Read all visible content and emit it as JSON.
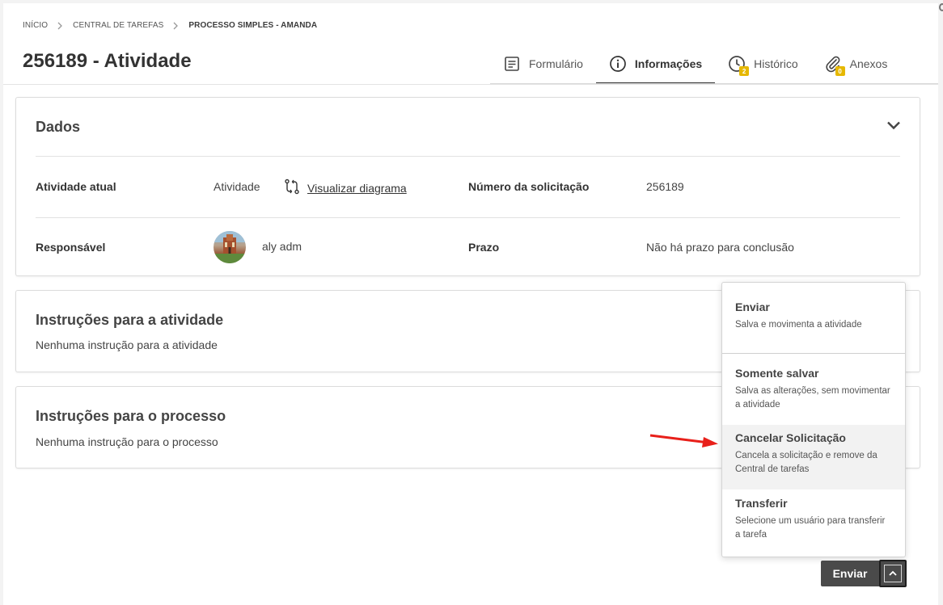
{
  "breadcrumb": [
    {
      "label": "INÍCIO"
    },
    {
      "label": "CENTRAL DE TAREFAS"
    },
    {
      "label": "PROCESSO SIMPLES - AMANDA"
    }
  ],
  "page": {
    "title": "256189 - Atividade"
  },
  "tabs": [
    {
      "label": "Formulário",
      "icon": "form-icon"
    },
    {
      "label": "Informações",
      "icon": "info-icon",
      "active": true
    },
    {
      "label": "Histórico",
      "icon": "clock-icon",
      "badge": "2"
    },
    {
      "label": "Anexos",
      "icon": "paperclip-icon",
      "badge": "0"
    }
  ],
  "dados": {
    "title": "Dados",
    "atividade_atual_label": "Atividade atual",
    "atividade_atual_value": "Atividade",
    "diagram_link": "Visualizar diagrama",
    "numero_label": "Número da solicitação",
    "numero_value": "256189",
    "responsavel_label": "Responsável",
    "responsavel_value": "aly adm",
    "prazo_label": "Prazo",
    "prazo_value": "Não há prazo para conclusão"
  },
  "instrucoes_atividade": {
    "title": "Instruções para a atividade",
    "text": "Nenhuma instrução para a atividade"
  },
  "instrucoes_processo": {
    "title": "Instruções para o processo",
    "text": "Nenhuma instrução para o processo"
  },
  "menu": [
    {
      "title": "Enviar",
      "desc": "Salva e movimenta a atividade"
    },
    {
      "title": "Somente salvar",
      "desc": "Salva as alterações, sem movimentar a atividade"
    },
    {
      "title": "Cancelar Solicitação",
      "desc": "Cancela a solicitação e remove da Central de tarefas"
    },
    {
      "title": "Transferir",
      "desc": "Selecione um usuário para transferir a tarefa"
    }
  ],
  "footer": {
    "send_label": "Enviar"
  },
  "colors": {
    "accent_badge": "#e6b800",
    "button_dark": "#4a4a4a",
    "arrow": "#e8201a"
  }
}
